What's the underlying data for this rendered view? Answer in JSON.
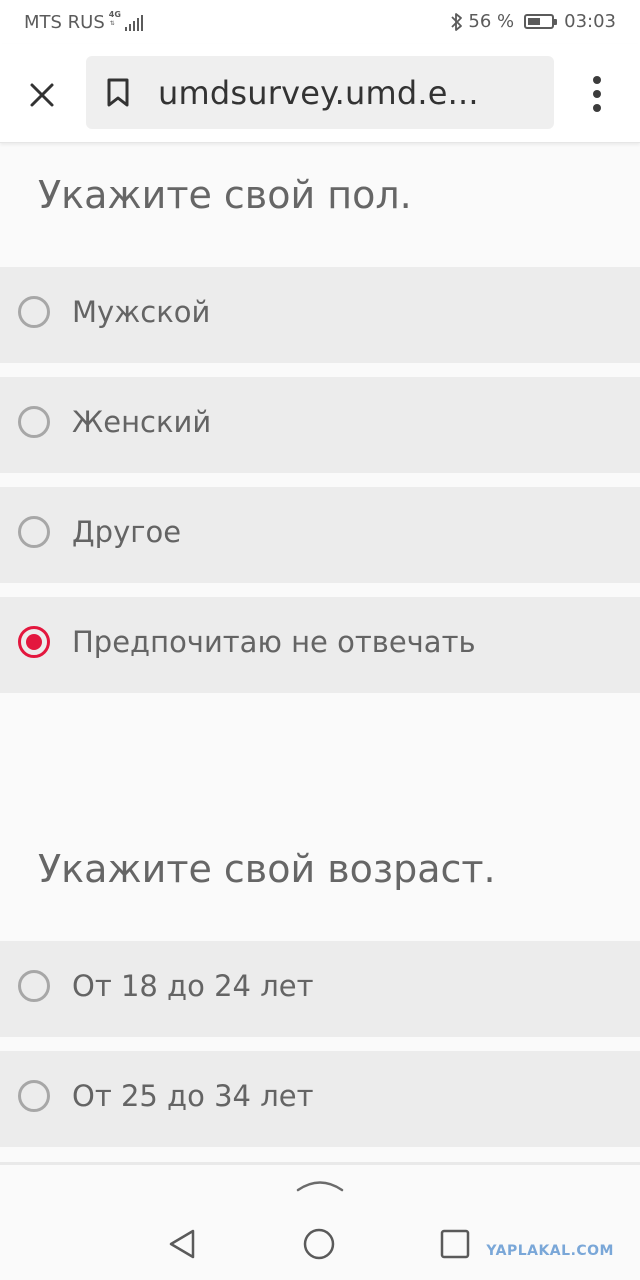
{
  "status_bar": {
    "carrier": "MTS RUS",
    "network": "4G",
    "battery_percent": "56 %",
    "battery_level": 0.56,
    "time": "03:03"
  },
  "toolbar": {
    "url": "umdsurvey.umd.e..."
  },
  "survey": {
    "questions": [
      {
        "title": "Укажите свой пол.",
        "options": [
          {
            "label": "Мужской",
            "selected": false
          },
          {
            "label": "Женский",
            "selected": false
          },
          {
            "label": "Другое",
            "selected": false
          },
          {
            "label": "Предпочитаю не отвечать",
            "selected": true
          }
        ]
      },
      {
        "title": "Укажите свой возраст.",
        "options": [
          {
            "label": "От 18 до 24 лет",
            "selected": false
          },
          {
            "label": "От 25 до 34 лет",
            "selected": false
          }
        ]
      }
    ]
  },
  "colors": {
    "accent": "#e3173e",
    "option_bg": "#ececec",
    "page_bg": "#fafafa"
  },
  "watermark": "YAPLAKAL.COM"
}
